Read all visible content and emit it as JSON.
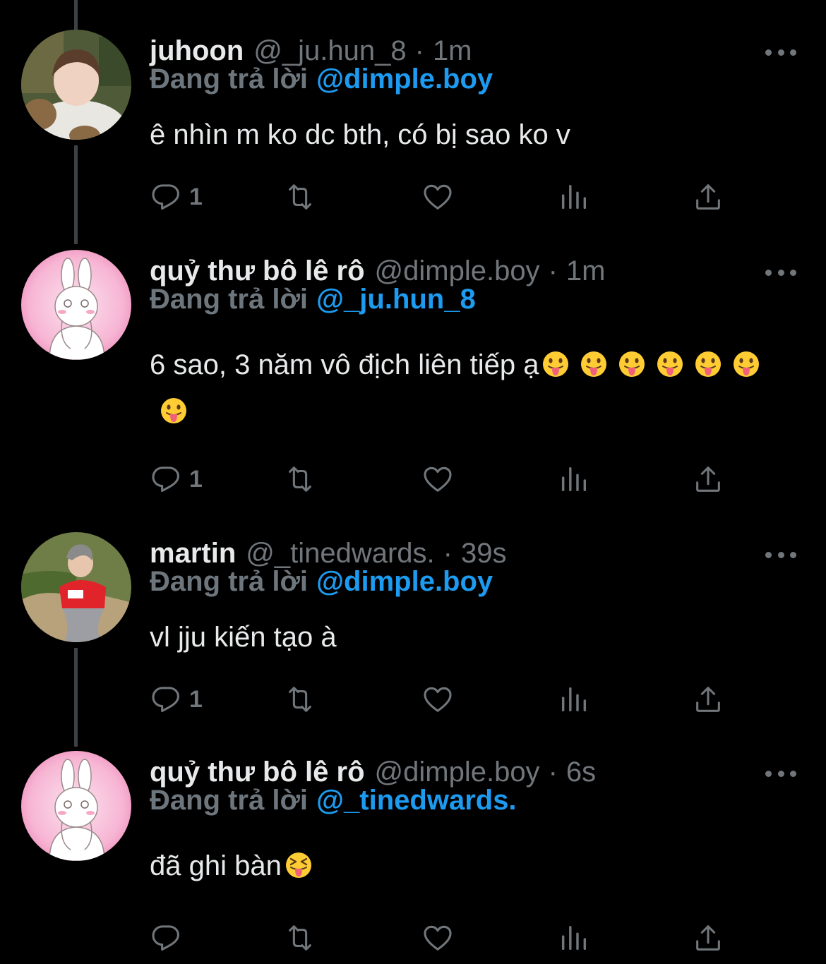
{
  "tweets": [
    {
      "name": "juhoon",
      "handle": "@_ju.hun_8",
      "time": "1m",
      "reply_prefix": "Đang trả lời",
      "reply_to": "@dimple.boy",
      "text": "ê nhìn m ko dc bth, có bị sao ko v",
      "emoji_count": 0,
      "reply_count": "1"
    },
    {
      "name": "quỷ thư bô lê rô",
      "handle": "@dimple.boy",
      "time": "1m",
      "reply_prefix": "Đang trả lời",
      "reply_to": "@_ju.hun_8",
      "text": "6 sao, 3 năm vô địch liên tiếp ạ",
      "emoji_count": 7,
      "emoji": "face-with-tongue",
      "reply_count": "1"
    },
    {
      "name": "martin",
      "handle": "@_tinedwards.",
      "time": "39s",
      "reply_prefix": "Đang trả lời",
      "reply_to": "@dimple.boy",
      "text": "vl jju kiến tạo à",
      "emoji_count": 0,
      "reply_count": "1"
    },
    {
      "name": "quỷ thư bô lê rô",
      "handle": "@dimple.boy",
      "time": "6s",
      "reply_prefix": "Đang trả lời",
      "reply_to": "@_tinedwards.",
      "text": "đã ghi bàn",
      "emoji_count": 1,
      "emoji": "squinting-face-with-tongue",
      "reply_count": ""
    }
  ],
  "icons": {
    "reply": "reply-icon",
    "retweet": "retweet-icon",
    "like": "heart-icon",
    "views": "views-icon",
    "share": "share-icon",
    "more": "more-icon"
  },
  "colors": {
    "background": "#000000",
    "text": "#e7e9ea",
    "secondary": "#71767b",
    "accent": "#1d9bf0",
    "thread_line": "#3e4144"
  }
}
